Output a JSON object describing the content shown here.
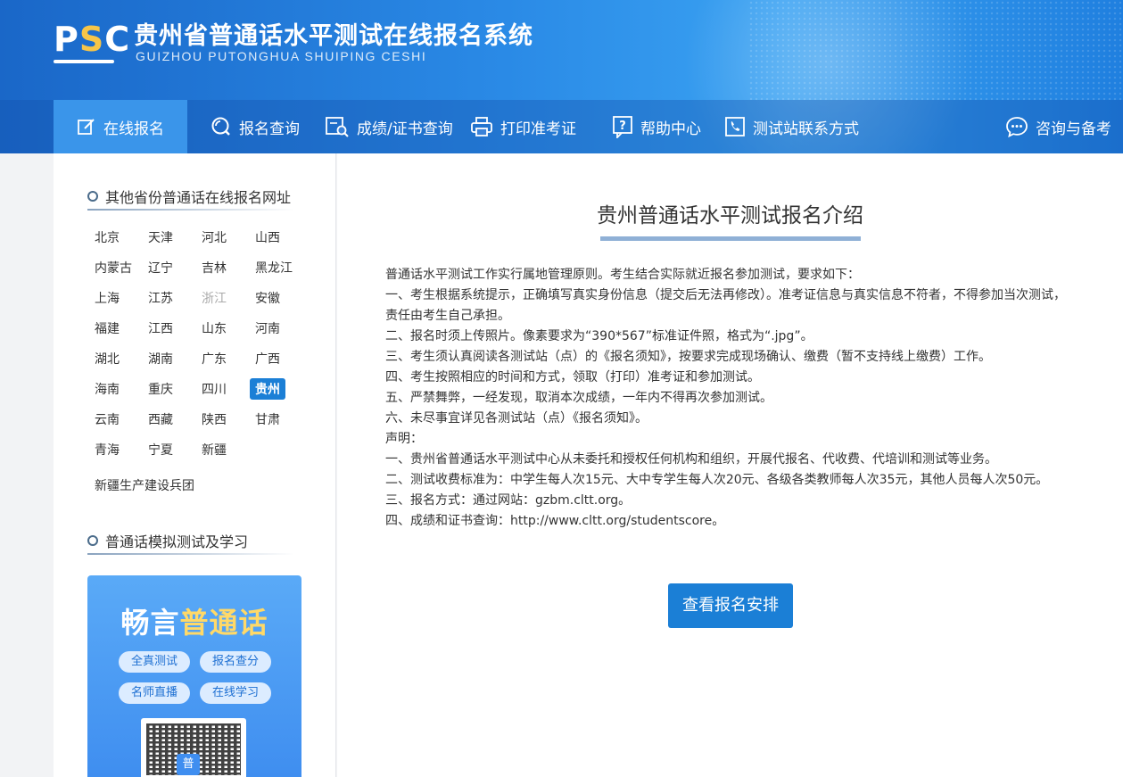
{
  "header": {
    "logo_text_p": "P",
    "logo_text_s": "S",
    "logo_text_c": "C",
    "title_cn": "贵州省普通话水平测试在线报名系统",
    "title_en": "GUIZHOU PUTONGHUA SHUIPING CESHI"
  },
  "nav": {
    "items": [
      {
        "label": "在线报名",
        "icon": "edit-icon"
      },
      {
        "label": "报名查询",
        "icon": "search-icon"
      },
      {
        "label": "成绩/证书查询",
        "icon": "certificate-search-icon"
      },
      {
        "label": "打印准考证",
        "icon": "printer-icon"
      },
      {
        "label": "帮助中心",
        "icon": "help-icon"
      },
      {
        "label": "测试站联系方式",
        "icon": "phone-icon"
      },
      {
        "label": "咨询与备考",
        "icon": "chat-icon"
      }
    ]
  },
  "sidebar": {
    "section1_title": "其他省份普通话在线报名网址",
    "provinces": [
      "北京",
      "天津",
      "河北",
      "山西",
      "内蒙古",
      "辽宁",
      "吉林",
      "黑龙江",
      "上海",
      "江苏",
      "浙江",
      "安徽",
      "福建",
      "江西",
      "山东",
      "河南",
      "湖北",
      "湖南",
      "广东",
      "广西",
      "海南",
      "重庆",
      "四川",
      "贵州",
      "云南",
      "西藏",
      "陕西",
      "甘肃",
      "青海",
      "宁夏",
      "新疆"
    ],
    "extra_province": "新疆生产建设兵团",
    "section2_title": "普通话模拟测试及学习",
    "promo": {
      "title_a": "畅言",
      "title_b": "普通话",
      "pills": [
        "全真测试",
        "报名查分",
        "名师直播",
        "在线学习"
      ],
      "qr_badge": "普"
    }
  },
  "main": {
    "title": "贵州普通话水平测试报名介绍",
    "lines": [
      "普通话水平测试工作实行属地管理原则。考生结合实际就近报名参加测试，要求如下：",
      "一、考生根据系统提示，正确填写真实身份信息（提交后无法再修改）。准考证信息与真实信息不符者，不得参加当次测试，",
      "责任由考生自己承担。",
      "二、报名时须上传照片。像素要求为“390*567”标准证件照，格式为“.jpg”。",
      "三、考生须认真阅读各测试站（点）的《报名须知》，按要求完成现场确认、缴费（暂不支持线上缴费）工作。",
      "四、考生按照相应的时间和方式，领取（打印）准考证和参加测试。",
      "五、严禁舞弊，一经发现，取消本次成绩，一年内不得再次参加测试。",
      "六、未尽事宜详见各测试站（点）《报名须知》。",
      "声明：",
      "一、贵州省普通话水平测试中心从未委托和授权任何机构和组织，开展代报名、代收费、代培训和测试等业务。",
      "二、测试收费标准为：中学生每人次15元、大中专学生每人次20元、各级各类教师每人次35元，其他人员每人次50元。",
      "三、报名方式：通过网站：gzbm.cltt.org。",
      "四、成绩和证书查询：http://www.cltt.org/studentscore。"
    ],
    "button_label": "查看报名安排"
  }
}
